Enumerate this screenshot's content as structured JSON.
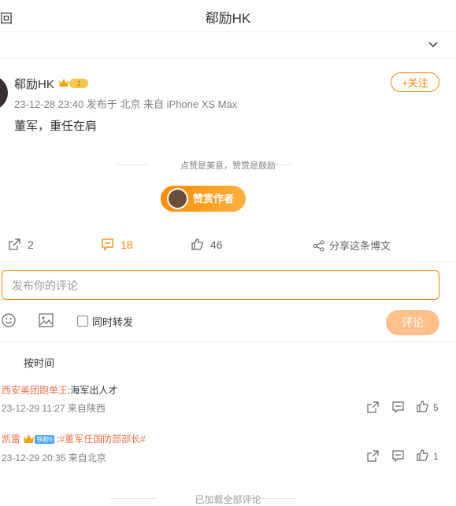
{
  "header": {
    "back_label": "回",
    "title": "郗励HK"
  },
  "post": {
    "username": "郗励HK",
    "level_badge": "1",
    "meta": "23-12-28 23:40  发布于 北京  来自 iPhone XS Max",
    "follow_label": "+关注",
    "content": "董军，重任在肩",
    "reward_tip": "点赞是美意，赞赏是鼓励",
    "reward_label": "赞赏作者"
  },
  "actions": {
    "repost_count": "2",
    "comment_count": "18",
    "like_count": "46",
    "share_label": "分享这条博文"
  },
  "comment_box": {
    "placeholder": "发布你的评论",
    "repost_checkbox_label": "同时转发",
    "submit_label": "评论"
  },
  "sort_label": "按时间",
  "comments": [
    {
      "user": "西安美团跑单王",
      "text": ":海军出人才",
      "meta": "23-12-29 11:27 来自陕西",
      "likes": "5"
    },
    {
      "user": "凯雷",
      "level": "铁粉5",
      "sep": " :",
      "hashtag": "#董军任国防部部长#",
      "meta": "23-12-29 20:35 来自北京",
      "likes": "1"
    }
  ],
  "footer_text": "已加载全部评论",
  "colors": {
    "accent": "#ff8200",
    "link": "#eb7350"
  }
}
